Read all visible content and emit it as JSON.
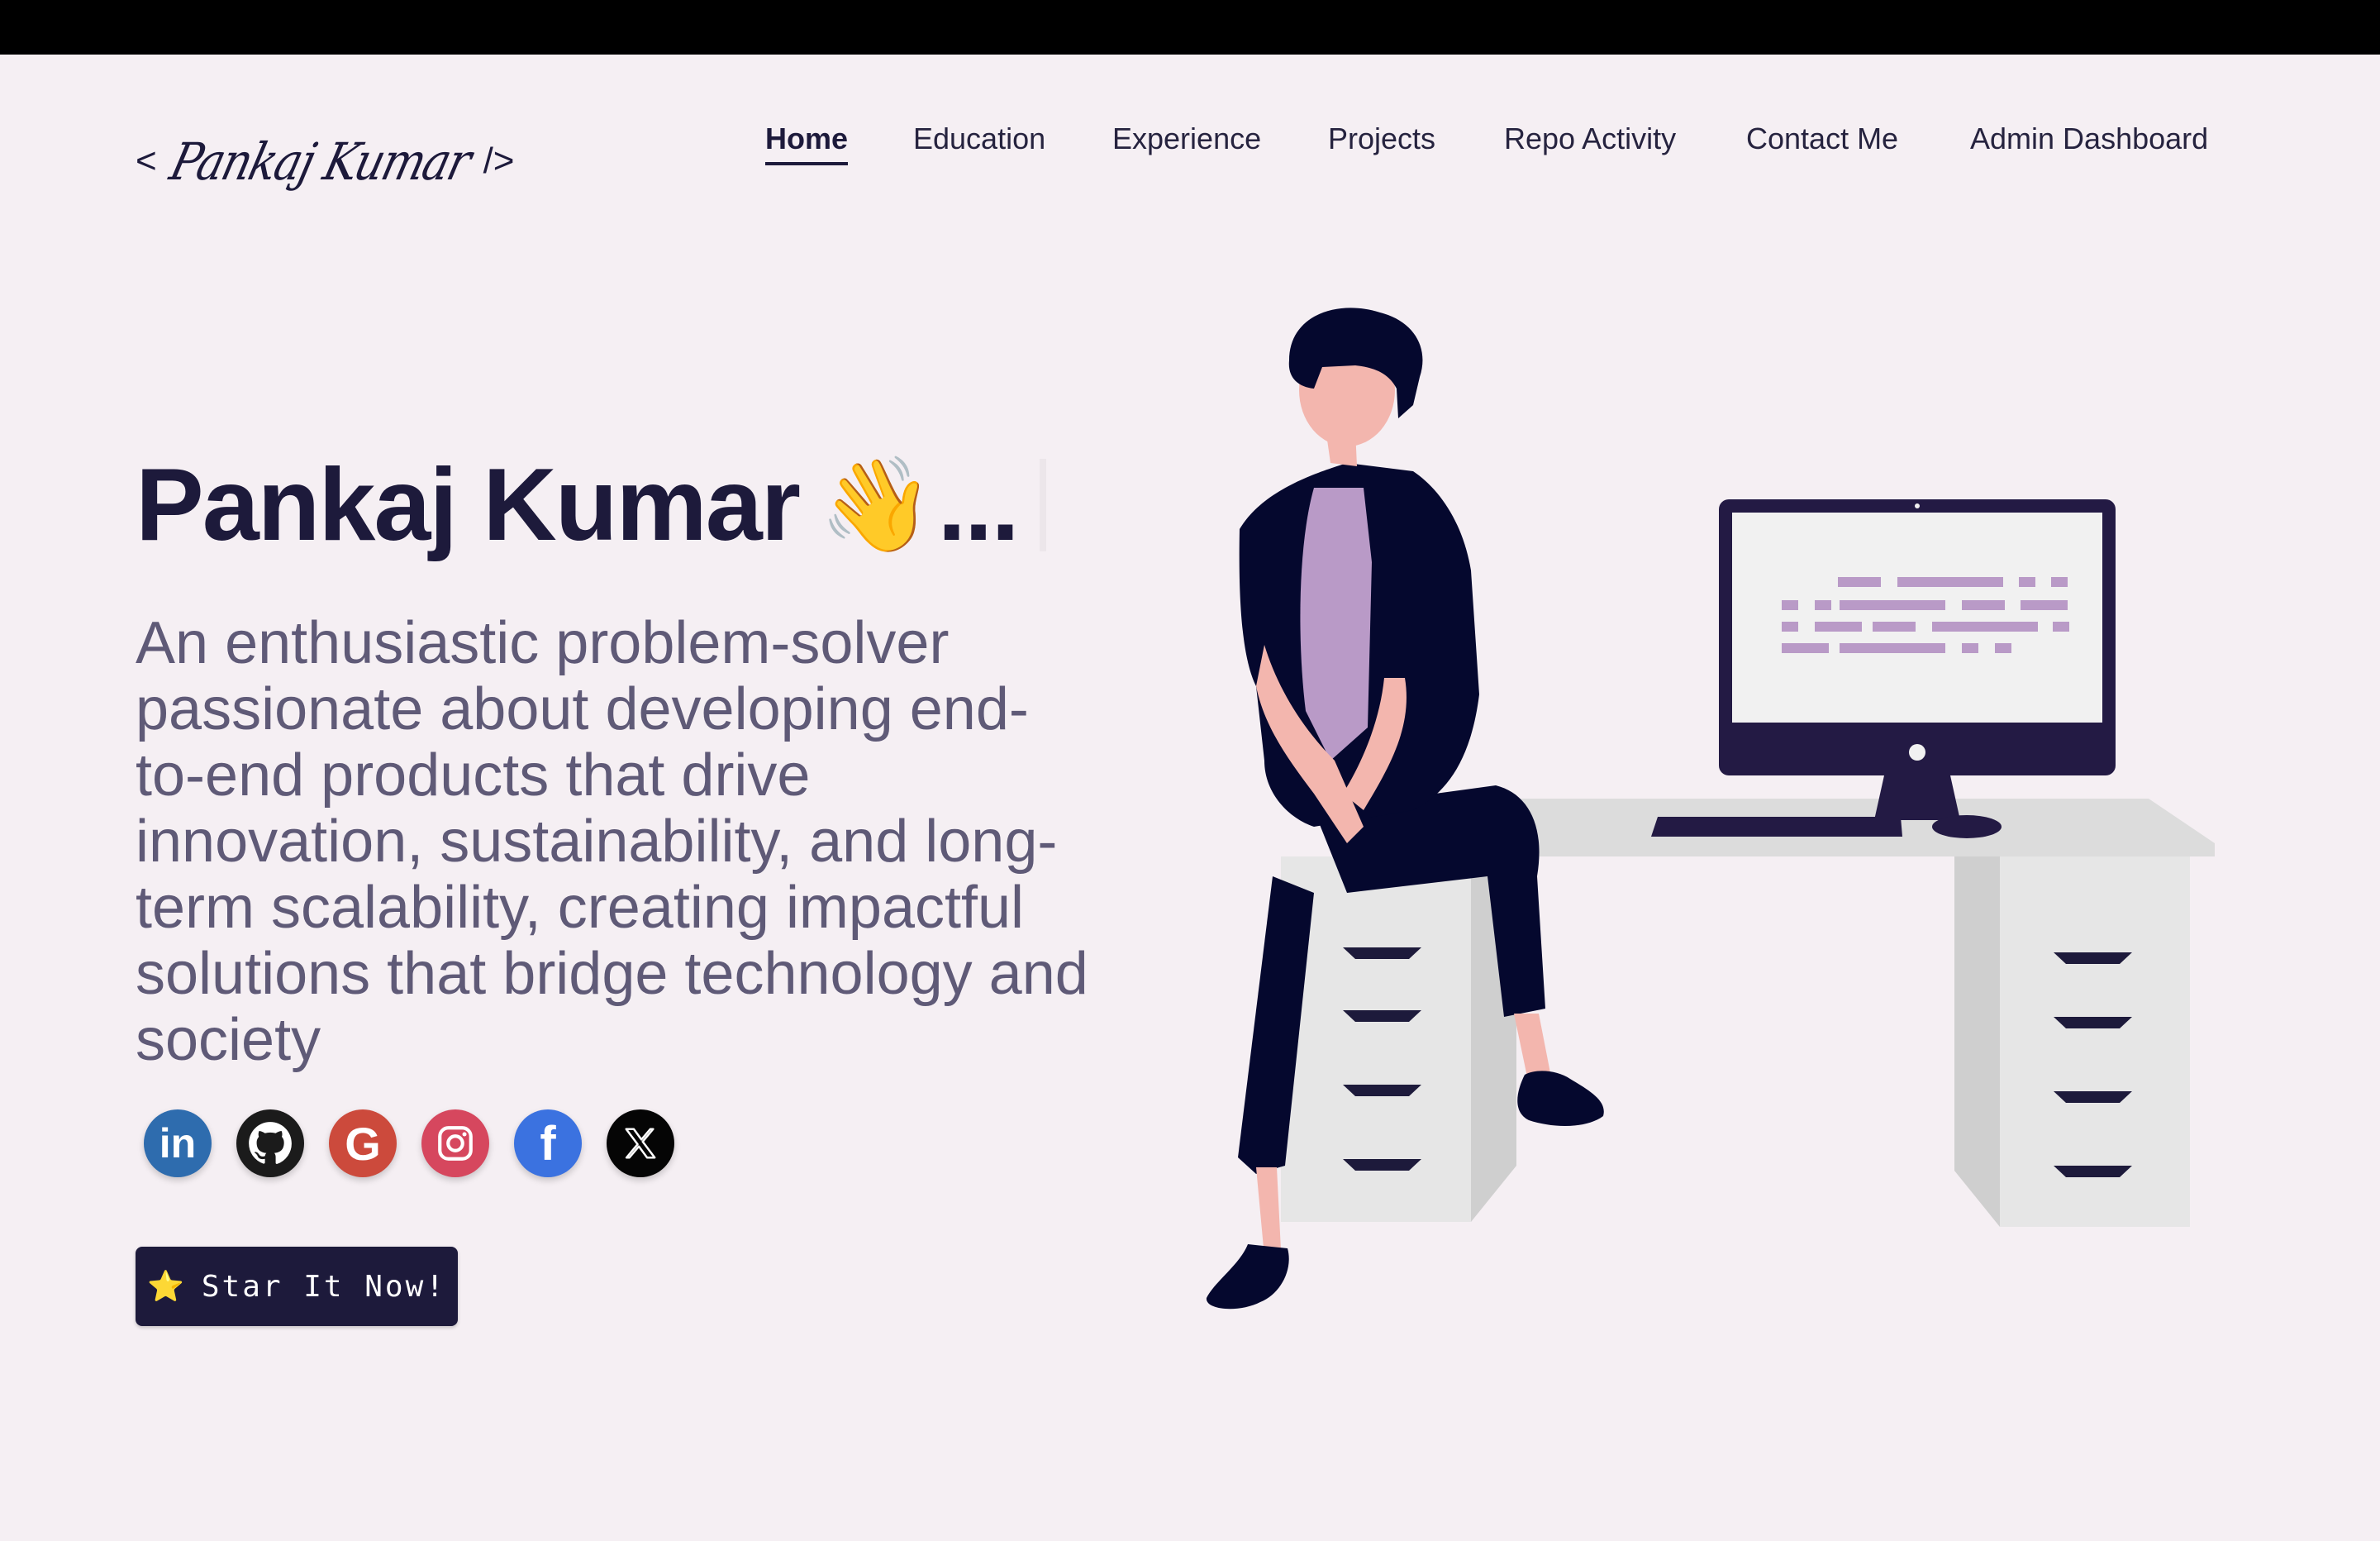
{
  "header": {
    "logo_open": "<",
    "logo_name": "Pankaj Kumar",
    "logo_close": "/>"
  },
  "nav": {
    "items": [
      {
        "label": "Home",
        "active": true
      },
      {
        "label": "Education",
        "active": false
      },
      {
        "label": "Experience",
        "active": false
      },
      {
        "label": "Projects",
        "active": false
      },
      {
        "label": "Repo Activity",
        "active": false
      },
      {
        "label": "Contact Me",
        "active": false
      },
      {
        "label": "Admin Dashboard",
        "active": false
      }
    ]
  },
  "hero": {
    "name": "Pankaj Kumar",
    "wave_emoji": "👋",
    "ellipsis": "...",
    "description": "An enthusiastic problem-solver passionate about developing end-to-end products that drive innovation, sustainability, and long-term scalability, creating impactful solutions that bridge technology and society"
  },
  "social": [
    {
      "name": "linkedin",
      "glyph": "in",
      "color": "#2e6cae"
    },
    {
      "name": "github",
      "glyph": "",
      "color": "#1b1b1b"
    },
    {
      "name": "google",
      "glyph": "G",
      "color": "#cc4a3c"
    },
    {
      "name": "instagram",
      "glyph": "",
      "color": "#d6475e"
    },
    {
      "name": "facebook",
      "glyph": "f",
      "color": "#3b72e0"
    },
    {
      "name": "x",
      "glyph": "",
      "color": "#050505"
    }
  ],
  "cta": {
    "star_emoji": "⭐",
    "label": "Star It Now!"
  },
  "colors": {
    "background": "#f5eff3",
    "primary": "#1d1a3b",
    "body_text": "#5f5a77",
    "accent_purple": "#b99ac7"
  }
}
